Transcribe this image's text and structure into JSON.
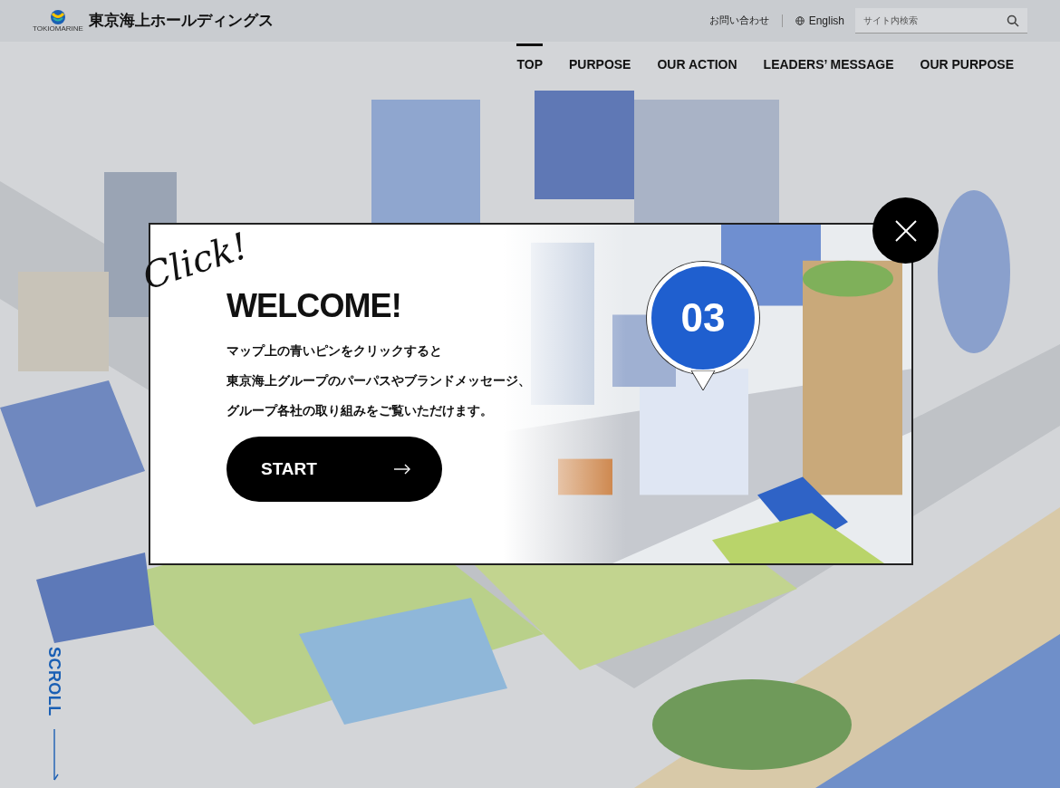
{
  "header": {
    "logo_caption": "TOKIOMARINE",
    "logo_text": "東京海上ホールディングス",
    "contact": "お問い合わせ",
    "language": "English",
    "search": {
      "placeholder": "サイト内検索"
    }
  },
  "nav": [
    {
      "label": "TOP",
      "selected": true
    },
    {
      "label": "PURPOSE",
      "selected": false
    },
    {
      "label": "OUR ACTION",
      "selected": false
    },
    {
      "label": "LEADERS’ MESSAGE",
      "selected": false
    },
    {
      "label": "OUR PURPOSE",
      "selected": false
    }
  ],
  "modal": {
    "script": "Click!",
    "title": "WELCOME!",
    "lines": [
      "マップ上の青いピンをクリックすると",
      "東京海上グループのパーパスやブランドメッセージ、",
      "グループ各社の取り組みをご覧いただけます。"
    ],
    "button": "START",
    "pin": "03"
  },
  "scroll": "SCROLL"
}
